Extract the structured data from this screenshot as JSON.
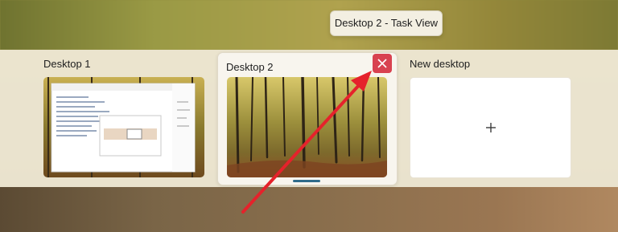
{
  "tooltip": {
    "text": "Desktop 2 - Task View"
  },
  "desktops": [
    {
      "label": "Desktop 1",
      "active": false
    },
    {
      "label": "Desktop 2",
      "active": true
    },
    {
      "label": "New desktop",
      "active": false
    }
  ],
  "icons": {
    "close": "close-icon",
    "add": "plus-icon"
  },
  "colors": {
    "close_button": "#d84250",
    "annotation_arrow": "#e5222b",
    "active_indicator": "#2f6b8a"
  }
}
